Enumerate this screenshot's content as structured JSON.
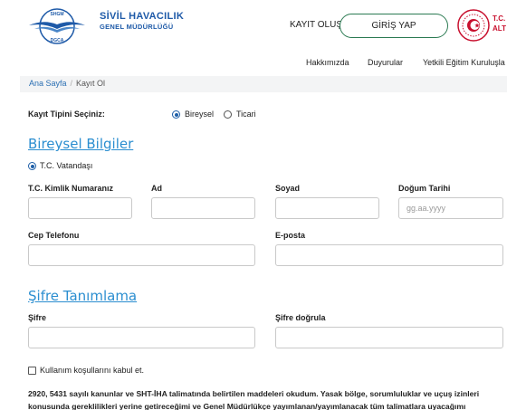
{
  "header": {
    "logo_top_text": "SHGM",
    "logo_bottom_text": "DGCA",
    "brand_line1": "SİVİL HAVACILIK",
    "brand_line2": "GENEL MÜDÜRLÜĞÜ",
    "register_label": "KAYIT OLUŞTUR",
    "login_label": "GİRİŞ YAP",
    "seal_text_line1": "T.C.",
    "seal_text_line2": "ALT",
    "colors": {
      "brand": "#1e5aa8",
      "login_border": "#2b7a52",
      "seal": "#c8102e"
    }
  },
  "nav": {
    "items": [
      "Hakkımızda",
      "Duyurular",
      "Yetkili Eğitim Kuruluşla"
    ]
  },
  "breadcrumb": {
    "home": "Ana Sayfa",
    "separator": "/",
    "current": "Kayıt Ol"
  },
  "registration_type": {
    "label": "Kayıt Tipini Seçiniz:",
    "options": [
      "Bireysel",
      "Ticari"
    ],
    "selected": "Bireysel"
  },
  "personal": {
    "title": "Bireysel Bilgiler",
    "citizen_option": "T.C. Vatandaşı",
    "fields": {
      "tc_label": "T.C. Kimlik Numaranız",
      "name_label": "Ad",
      "surname_label": "Soyad",
      "birth_label": "Doğum Tarihi",
      "birth_placeholder": "gg.aa.yyyy",
      "phone_label": "Cep Telefonu",
      "email_label": "E-posta"
    }
  },
  "password": {
    "title": "Şifre Tanımlama",
    "password_label": "Şifre",
    "confirm_label": "Şifre doğrula"
  },
  "terms": {
    "checkbox_label": "Kullanım koşullarını kabul et.",
    "paragraph_line1": "2920, 5431 sayılı kanunlar ve SHT-İHA talimatında belirtilen maddeleri okudum. Yasak bölge, sorumluluklar ve uçuş izinleri",
    "paragraph_line2": "konusunda gereklilikleri yerine getireceğimi ve Genel Müdürlükçe yayımlanan/yayımlanacak tüm talimatlara uyacağımı"
  },
  "accent_color": "#2b8ed0"
}
